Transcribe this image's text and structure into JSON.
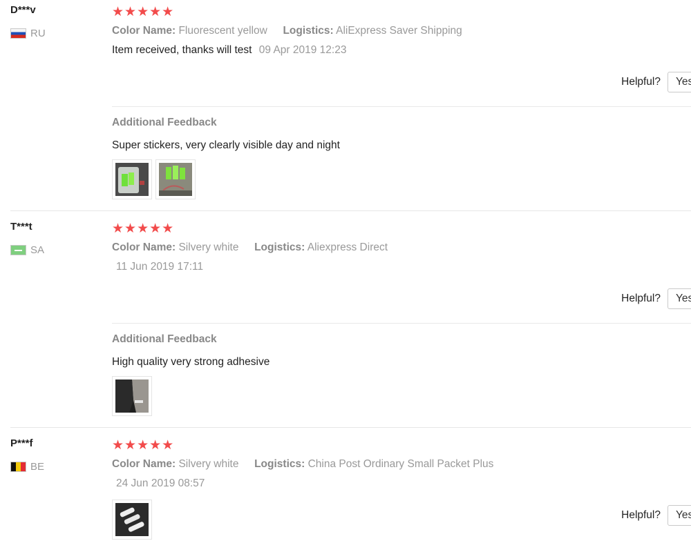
{
  "reviews": [
    {
      "user": "D***v",
      "country": "RU",
      "stars": "★★★★★",
      "color_key": "Color Name:",
      "color_value": "Fluorescent yellow",
      "logistics_key": "Logistics:",
      "logistics_value": "AliExpress Saver Shipping",
      "comment": "Item received, thanks will test",
      "date": "09 Apr 2019 12:23",
      "helpful_label": "Helpful?",
      "yes_label": "Yes",
      "additional_title": "Additional Feedback",
      "additional_text": "Super stickers, very clearly visible day and night",
      "photos": [
        "photo-green-stickers-phone",
        "photo-green-stickers-hand"
      ]
    },
    {
      "user": "T***t",
      "country": "SA",
      "stars": "★★★★★",
      "color_key": "Color Name:",
      "color_value": "Silvery white",
      "logistics_key": "Logistics:",
      "logistics_value": "Aliexpress Direct",
      "comment": "",
      "date": "11 Jun 2019 17:11",
      "helpful_label": "Helpful?",
      "yes_label": "Yes",
      "additional_title": "Additional Feedback",
      "additional_text": "High quality very strong adhesive",
      "photos": [
        "photo-sticker-on-door"
      ]
    },
    {
      "user": "P***f",
      "country": "BE",
      "stars": "★★★★★",
      "color_key": "Color Name:",
      "color_value": "Silvery white",
      "logistics_key": "Logistics:",
      "logistics_value": "China Post Ordinary Small Packet Plus",
      "comment": "",
      "date": "24 Jun 2019 08:57",
      "helpful_label": "Helpful?",
      "yes_label": "Yes",
      "photos": [
        "photo-white-reflective-strips"
      ]
    }
  ],
  "colors": {
    "star": "#f24b4b",
    "muted_text": "#999999",
    "text": "#222222",
    "divider": "#e6e6e6"
  }
}
